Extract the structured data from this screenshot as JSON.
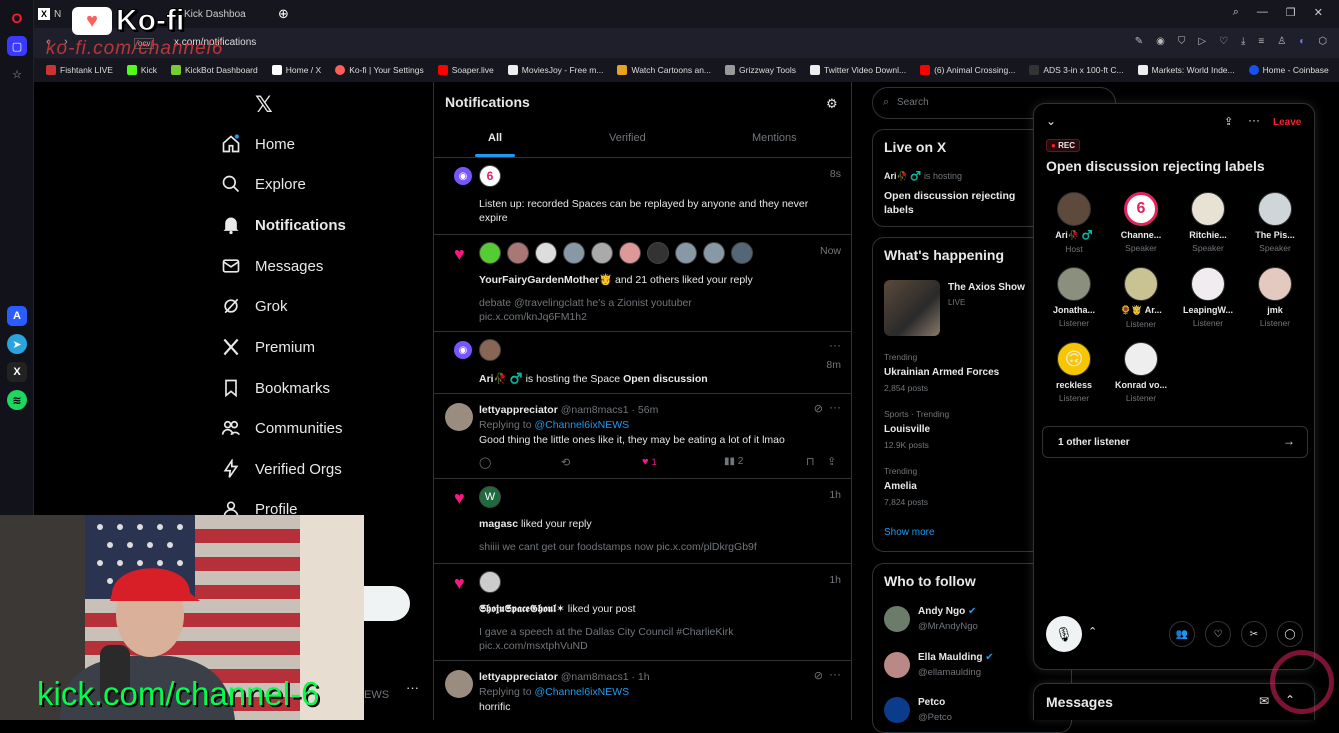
{
  "browser": {
    "tabs": [
      {
        "label": "N"
      },
      {
        "label": "Kick Dashboa"
      }
    ],
    "url": "x.com/notifications",
    "url_prefix": "ocv",
    "bookmarks": [
      "Fishtank LIVE",
      "Kick",
      "KickBot Dashboard",
      "Home / X",
      "Ko-fi | Your Settings",
      "Soaper.live",
      "MoviesJoy - Free m...",
      "Watch Cartoons an...",
      "Grizzway Tools",
      "Twitter Video Downl...",
      "(6) Animal Crossing...",
      "ADS 3-in x 100-ft C...",
      "Markets: World Inde...",
      "Home - Coinbase"
    ]
  },
  "overlay": {
    "kofi_text": "Ko-fi",
    "kofi_url": "ko-fi.com/channel6",
    "kick_url": "kick.com/channel-6"
  },
  "nav": {
    "items": [
      {
        "label": "Home",
        "icon": "home-icon"
      },
      {
        "label": "Explore",
        "icon": "search-icon"
      },
      {
        "label": "Notifications",
        "icon": "bell-icon"
      },
      {
        "label": "Messages",
        "icon": "envelope-icon"
      },
      {
        "label": "Grok",
        "icon": "grok-icon"
      },
      {
        "label": "Premium",
        "icon": "x-logo-icon"
      },
      {
        "label": "Bookmarks",
        "icon": "bookmark-icon"
      },
      {
        "label": "Communities",
        "icon": "people-icon"
      },
      {
        "label": "Verified Orgs",
        "icon": "lightning-icon"
      },
      {
        "label": "Profile",
        "icon": "person-icon"
      }
    ],
    "footer_partial": "EWS"
  },
  "notifications": {
    "title": "Notifications",
    "tabs": [
      "All",
      "Verified",
      "Mentions"
    ],
    "active_tab": "All",
    "items": [
      {
        "time": "8s",
        "text": "Listen up: recorded Spaces can be replayed by anyone and they never expire"
      },
      {
        "time": "Now",
        "name": "YourFairyGardenMother🫅",
        "rest": " and 21 others liked your reply",
        "quote": "debate @travelingclatt he's a Zionist youtuber",
        "link": "pic.x.com/knJq6FM1h2"
      },
      {
        "time": "8m",
        "name": "Ari🥀 ♂️",
        "rest": " is hosting the Space ",
        "space": "Open discussion"
      },
      {
        "time": "56m",
        "user": "lettyappreciator",
        "handle": "@nam8macs1 · 56m",
        "reply_label": "Replying to ",
        "reply_to": "@Channel6ixNEWS",
        "body": "Good thing the little ones like it, they may be eating a lot of it lmao",
        "likes": "1",
        "views": "2"
      },
      {
        "time": "1h",
        "name": "magasc",
        "rest": " liked your reply",
        "quote": "shiiii we cant get our foodstamps now pic.x.com/plDkrgGb9f"
      },
      {
        "time": "1h",
        "name": "𝕾𝖍𝖔𝖏𝖚𝕾𝖕𝖆𝖈𝖊𝕲𝖍𝖔𝖚𝖑✶",
        "rest": " liked your post",
        "quote": "I gave a speech at the Dallas City Council #CharlieKirk",
        "link": "pic.x.com/msxtphVuND"
      },
      {
        "time": "1h",
        "user": "lettyappreciator",
        "handle": "@nam8macs1 · 1h",
        "reply_label": "Replying to ",
        "reply_to": "@Channel6ixNEWS",
        "body": "horrific"
      }
    ]
  },
  "sidebar": {
    "search_placeholder": "Search",
    "live_title": "Live on X",
    "live_host": "Ari🥀 ♂️",
    "live_status": "is hosting",
    "live_space": "Open discussion rejecting labels",
    "happening_title": "What's happening",
    "happening_show": "The Axios Show",
    "happening_live": "LIVE",
    "trends": [
      {
        "meta": "Trending",
        "name": "Ukrainian Armed Forces",
        "posts": "2,854 posts"
      },
      {
        "meta": "Sports · Trending",
        "name": "Louisville",
        "posts": "12.9K posts"
      },
      {
        "meta": "Trending",
        "name": "Amelia",
        "posts": "7,824 posts"
      }
    ],
    "show_more": "Show more",
    "follow_title": "Who to follow",
    "follows": [
      {
        "name": "Andy Ngo",
        "handle": "@MrAndyNgo"
      },
      {
        "name": "Ella Maulding",
        "handle": "@ellamaulding"
      },
      {
        "name": "Petco",
        "handle": "@Petco"
      }
    ]
  },
  "space": {
    "rec": "REC",
    "leave": "Leave",
    "title": "Open discussion rejecting labels",
    "participants": [
      {
        "name": "Ari🥀 ♂️",
        "role": "Host"
      },
      {
        "name": "Channe...",
        "role": "Speaker"
      },
      {
        "name": "Ritchie...",
        "role": "Speaker"
      },
      {
        "name": "The Pis...",
        "role": "Speaker"
      },
      {
        "name": "Jonatha...",
        "role": "Listener"
      },
      {
        "name": "🌻🤴 Ar...",
        "role": "Listener"
      },
      {
        "name": "LeapingW...",
        "role": "Listener"
      },
      {
        "name": "jmk",
        "role": "Listener"
      },
      {
        "name": "reckless",
        "role": "Listener"
      },
      {
        "name": "Konrad vo...",
        "role": "Listener"
      }
    ],
    "other_listener": "1 other listener"
  },
  "messages_drawer": {
    "title": "Messages"
  },
  "colors": {
    "accent": "#1d9bf0",
    "like": "#f91880",
    "leave": "#f4212e",
    "purple": "#7856ff"
  }
}
